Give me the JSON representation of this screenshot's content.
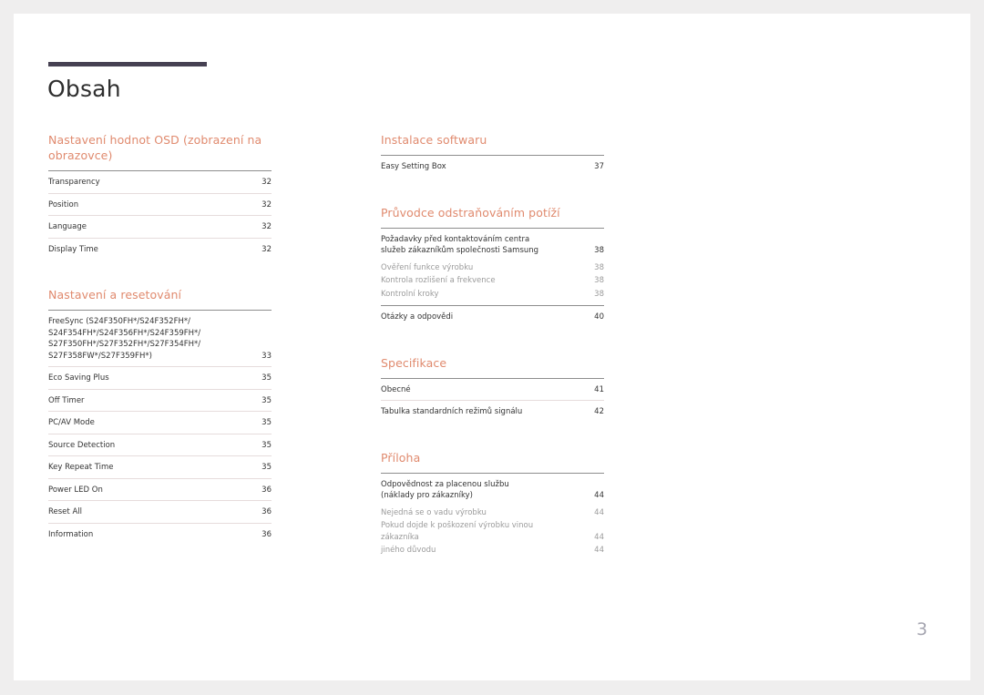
{
  "document": {
    "title": "Obsah",
    "page_number": "3",
    "accent_color": "#e08a6e",
    "title_bar_color": "#464152",
    "page_number_color": "#a5a5b0"
  },
  "left_column": {
    "sections": [
      {
        "heading": "Nastavení hodnot OSD (zobrazení na obrazovce)",
        "entries": [
          {
            "label": "Transparency",
            "page": "32",
            "sub": false
          },
          {
            "label": "Position",
            "page": "32",
            "sub": false
          },
          {
            "label": "Language",
            "page": "32",
            "sub": false
          },
          {
            "label": "Display Time",
            "page": "32",
            "sub": false
          }
        ]
      },
      {
        "heading": "Nastavení a resetování",
        "entries": [
          {
            "label": "FreeSync (S24F350FH*/S24F352FH*/\nS24F354FH*/S24F356FH*/S24F359FH*/\nS27F350FH*/S27F352FH*/S27F354FH*/\nS27F358FW*/S27F359FH*)",
            "page": "33",
            "sub": false
          },
          {
            "label": "Eco Saving Plus",
            "page": "35",
            "sub": false
          },
          {
            "label": "Off Timer",
            "page": "35",
            "sub": false
          },
          {
            "label": "PC/AV Mode",
            "page": "35",
            "sub": false
          },
          {
            "label": "Source Detection",
            "page": "35",
            "sub": false
          },
          {
            "label": "Key Repeat Time",
            "page": "35",
            "sub": false
          },
          {
            "label": "Power LED On",
            "page": "36",
            "sub": false
          },
          {
            "label": "Reset All",
            "page": "36",
            "sub": false
          },
          {
            "label": "Information",
            "page": "36",
            "sub": false
          }
        ]
      }
    ]
  },
  "right_column": {
    "sections": [
      {
        "heading": "Instalace softwaru",
        "entries": [
          {
            "label": "Easy Setting Box",
            "page": "37",
            "sub": false
          }
        ]
      },
      {
        "heading": "Průvodce odstraňováním potíží",
        "entries": [
          {
            "label": "Požadavky před kontaktováním centra\nslužeb zákazníkům společnosti Samsung",
            "page": "38",
            "sub": false
          },
          {
            "label": "Ověření funkce výrobku",
            "page": "38",
            "sub": true
          },
          {
            "label": "Kontrola rozlišení a frekvence",
            "page": "38",
            "sub": true
          },
          {
            "label": "Kontrolní kroky",
            "page": "38",
            "sub": true
          },
          {
            "label": "Otázky a odpovědi",
            "page": "40",
            "sub": false,
            "rule_strong": true
          }
        ]
      },
      {
        "heading": "Specifikace",
        "entries": [
          {
            "label": "Obecné",
            "page": "41",
            "sub": false
          },
          {
            "label": "Tabulka standardních režimů signálu",
            "page": "42",
            "sub": false
          }
        ]
      },
      {
        "heading": "Příloha",
        "entries": [
          {
            "label": "Odpovědnost za placenou službu\n(náklady pro zákazníky)",
            "page": "44",
            "sub": false
          },
          {
            "label": "Nejedná se o vadu výrobku",
            "page": "44",
            "sub": true
          },
          {
            "label": "Pokud dojde k poškození výrobku vinou\nzákazníka",
            "page": "44",
            "sub": true
          },
          {
            "label": "jiného důvodu",
            "page": "44",
            "sub": true
          }
        ]
      }
    ]
  }
}
